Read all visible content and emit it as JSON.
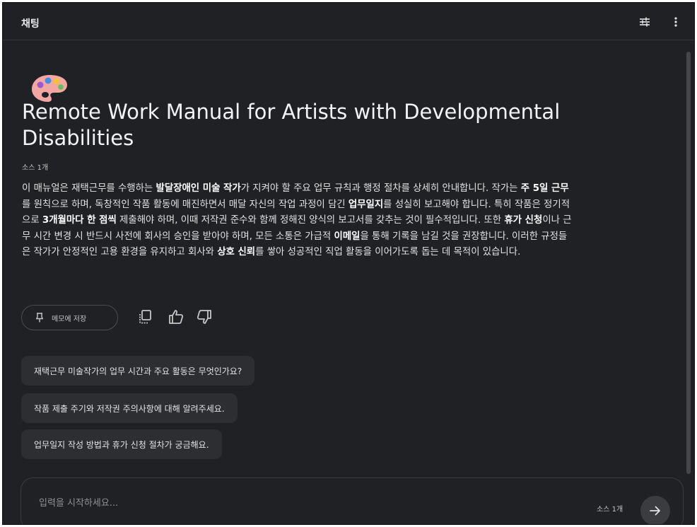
{
  "header": {
    "title": "채팅",
    "icons": [
      "tune-icon",
      "more-vert-icon"
    ]
  },
  "notebook": {
    "emoji": "🎨",
    "title": "Remote Work Manual for Artists with Developmental Disabilities",
    "source_count": "소스 1개",
    "summary": [
      {
        "t": "이 매뉴얼은 재택근무를 수행하는 ",
        "b": false
      },
      {
        "t": "발달장애인 미술 작가",
        "b": true
      },
      {
        "t": "가 지켜야 할 주요 업무 규칙과 행정 절차를 상세히 안내합니다. 작가는 ",
        "b": false
      },
      {
        "t": "주 5일 근무",
        "b": true
      },
      {
        "t": "를 원칙으로 하며, 독창적인 작품 활동에 매진하면서 매달 자신의 작업 과정이 담긴 ",
        "b": false
      },
      {
        "t": "업무일지",
        "b": true
      },
      {
        "t": "를 성실히 보고해야 합니다. 특히 작품은 정기적으로 ",
        "b": false
      },
      {
        "t": "3개월마다 한 점씩",
        "b": true
      },
      {
        "t": " 제출해야 하며, 이때 저작권 준수와 함께 정해진 양식의 보고서를 갖추는 것이 필수적입니다. 또한 ",
        "b": false
      },
      {
        "t": "휴가 신청",
        "b": true
      },
      {
        "t": "이나 근무 시간 변경 시 반드시 사전에 회사의 승인을 받아야 하며, 모든 소통은 가급적 ",
        "b": false
      },
      {
        "t": "이메일",
        "b": true
      },
      {
        "t": "을 통해 기록을 남길 것을 권장합니다. 이러한 규정들은 작가가 안정적인 고용 환경을 유지하고 회사와 ",
        "b": false
      },
      {
        "t": "상호 신뢰",
        "b": true
      },
      {
        "t": "를 쌓아 성공적인 직업 활동을 이어가도록 돕는 데 목적이 있습니다.",
        "b": false
      }
    ]
  },
  "actions": {
    "save_note_label": "메모에 저장",
    "icons": [
      "pin-icon",
      "copy-icon",
      "thumbs-up-icon",
      "thumbs-down-icon"
    ]
  },
  "suggestions": [
    "재택근무 미술작가의 업무 시간과 주요 활동은 무엇인가요?",
    "작품 제출 주기와 저작권 주의사항에 대해 알려주세요.",
    "업무일지 작성 방법과 휴가 신청 절차가 궁금해요."
  ],
  "composer": {
    "placeholder": "입력을 시작하세요...",
    "source_count": "소스 1개",
    "send_icon": "arrow-right-icon"
  },
  "colors": {
    "background": "#202124",
    "surface": "#2d2e31",
    "text": "#e3e3e3",
    "muted": "#c4c7c5",
    "border": "#3a3c40"
  }
}
